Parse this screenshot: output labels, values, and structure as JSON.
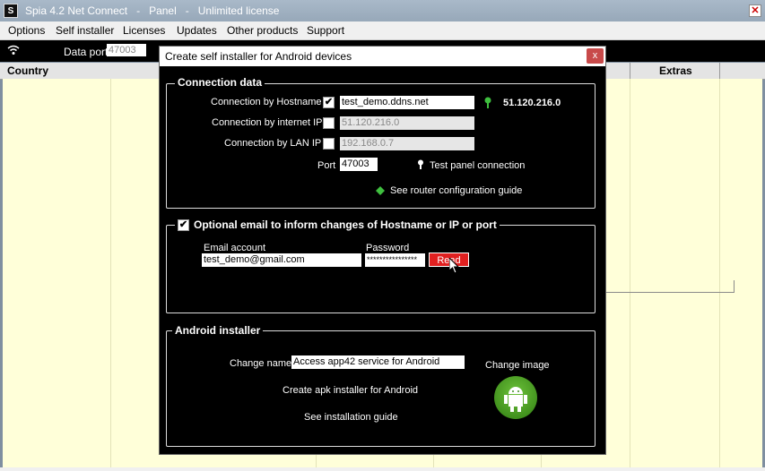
{
  "window": {
    "title": "Spia 4.2 Net Connect   -   Panel   -   Unlimited license",
    "icon": "app-logo-icon",
    "close_icon": "close-icon"
  },
  "menu": [
    "Options",
    "Self installer",
    "Licenses",
    "Updates",
    "Other products",
    "Support"
  ],
  "toolbar": {
    "dataport_label": "Data port",
    "dataport_value": "47003"
  },
  "table": {
    "columns": [
      "Country",
      "Extras"
    ]
  },
  "dialog": {
    "title": "Create self installer for Android devices",
    "close_label": "x",
    "connection": {
      "legend": "Connection data",
      "hostname_label": "Connection by Hostname",
      "hostname_checked": true,
      "hostname_value": "test_demo.ddns.net",
      "resolved_ip": "51.120.216.0",
      "ip_label": "Connection by internet IP",
      "ip_checked": false,
      "ip_value": "51.120.216.0",
      "lan_label": "Connection by LAN IP",
      "lan_checked": false,
      "lan_value": "192.168.0.7",
      "port_label": "Port",
      "port_value": "47003",
      "test_link": "Test panel connection",
      "router_link": "See router configuration guide"
    },
    "email": {
      "legend": "Optional email to inform changes of Hostname or IP or port",
      "checked": true,
      "account_label": "Email account",
      "account_value": "test_demo@gmail.com",
      "password_label": "Password",
      "password_value": "****************",
      "read_label": "Read"
    },
    "android": {
      "legend": "Android installer",
      "change_name_label": "Change name",
      "name_value": "Access app42 service for Android",
      "change_image_label": "Change image",
      "create_label": "Create apk installer for Android",
      "guide_label": "See installation guide"
    }
  },
  "colors": {
    "read_button": "#e02020",
    "android_green": "#4caa23",
    "grid_bg": "#ffffd9"
  }
}
